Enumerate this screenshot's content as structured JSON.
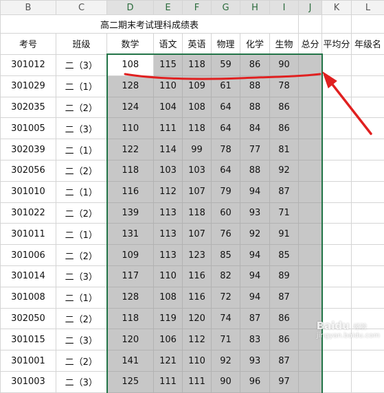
{
  "columns": [
    "B",
    "C",
    "D",
    "E",
    "F",
    "G",
    "H",
    "I",
    "J",
    "K",
    "L"
  ],
  "title": "高二期末考试理科成绩表",
  "headers": [
    "考号",
    "班级",
    "数学",
    "语文",
    "英语",
    "物理",
    "化学",
    "生物",
    "总分",
    "平均分",
    "年级名"
  ],
  "rows": [
    [
      "301012",
      "二（3）",
      "108",
      "115",
      "118",
      "59",
      "86",
      "90"
    ],
    [
      "301029",
      "二（1）",
      "128",
      "110",
      "109",
      "61",
      "88",
      "78"
    ],
    [
      "302035",
      "二（2）",
      "124",
      "104",
      "108",
      "64",
      "88",
      "86"
    ],
    [
      "301005",
      "二（3）",
      "110",
      "111",
      "118",
      "64",
      "84",
      "86"
    ],
    [
      "302039",
      "二（1）",
      "122",
      "114",
      "99",
      "78",
      "77",
      "81"
    ],
    [
      "302056",
      "二（2）",
      "118",
      "103",
      "103",
      "64",
      "88",
      "92"
    ],
    [
      "301010",
      "二（1）",
      "116",
      "112",
      "107",
      "79",
      "94",
      "87"
    ],
    [
      "301022",
      "二（2）",
      "139",
      "113",
      "118",
      "60",
      "93",
      "71"
    ],
    [
      "301011",
      "二（1）",
      "131",
      "113",
      "107",
      "76",
      "92",
      "91"
    ],
    [
      "301006",
      "二（2）",
      "109",
      "113",
      "123",
      "85",
      "94",
      "85"
    ],
    [
      "301014",
      "二（3）",
      "117",
      "110",
      "116",
      "82",
      "94",
      "89"
    ],
    [
      "301008",
      "二（1）",
      "128",
      "108",
      "116",
      "72",
      "94",
      "87"
    ],
    [
      "302050",
      "二（2）",
      "118",
      "119",
      "120",
      "74",
      "87",
      "86"
    ],
    [
      "301015",
      "二（3）",
      "120",
      "106",
      "112",
      "71",
      "83",
      "86"
    ],
    [
      "301001",
      "二（2）",
      "141",
      "121",
      "110",
      "92",
      "93",
      "87"
    ],
    [
      "301003",
      "二（3）",
      "125",
      "111",
      "111",
      "90",
      "96",
      "97"
    ]
  ],
  "selection": {
    "start_col": "D",
    "end_col": "J",
    "start_row": 1,
    "active_cell": "D"
  },
  "annotation_color": "#e02020",
  "selection_border_color": "#217346",
  "selection_fill_color": "#c7c7c7",
  "watermark": {
    "brand": "Baidu",
    "sub": "经验",
    "url": "jingyan.baidu.com"
  }
}
